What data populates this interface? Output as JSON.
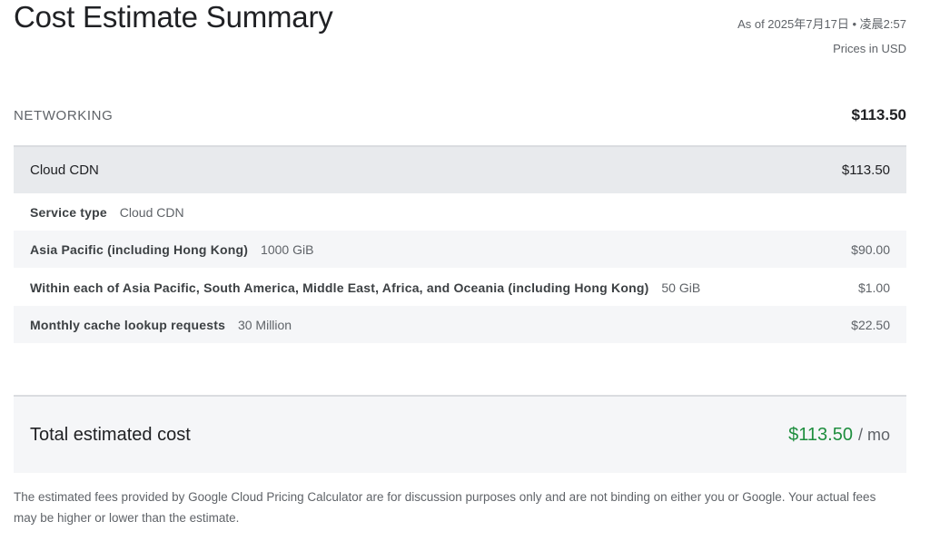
{
  "header": {
    "title": "Cost Estimate Summary",
    "as_of": "As of 2025年7月17日 • 凌晨2:57",
    "currency_note": "Prices in USD"
  },
  "section": {
    "label": "NETWORKING",
    "total": "$113.50"
  },
  "product": {
    "name": "Cloud CDN",
    "cost": "$113.50",
    "line_items": [
      {
        "label": "Service type",
        "value": "Cloud CDN",
        "cost": ""
      },
      {
        "label": "Asia Pacific (including Hong Kong)",
        "value": "1000 GiB",
        "cost": "$90.00"
      },
      {
        "label": "Within each of Asia Pacific, South America, Middle East, Africa, and Oceania (including Hong Kong)",
        "value": "50 GiB",
        "cost": "$1.00"
      },
      {
        "label": "Monthly cache lookup requests",
        "value": "30 Million",
        "cost": "$22.50"
      }
    ]
  },
  "total": {
    "label": "Total estimated cost",
    "amount": "$113.50",
    "unit": "/ mo",
    "amount_color": "#1e8e3e"
  },
  "disclaimer": "The estimated fees provided by Google Cloud Pricing Calculator are for discussion purposes only and are not binding on either you or Google. Your actual fees may be higher or lower than the estimate."
}
